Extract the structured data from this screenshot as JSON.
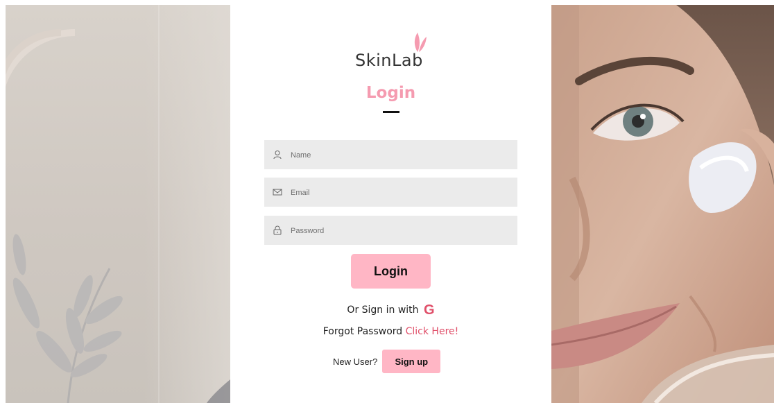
{
  "brand": {
    "name_part1": "SkinL",
    "name_part2": "ab",
    "accent": "#f59bb0",
    "link_color": "#e0506a"
  },
  "form": {
    "title": "Login",
    "fields": {
      "name_placeholder": "Name",
      "email_placeholder": "Email",
      "password_placeholder": "Password"
    },
    "login_button": "Login",
    "or_sign_in_text": "Or Sign in with",
    "google_icon_glyph": "G",
    "forgot_text": "Forgot Password",
    "forgot_link": "Click Here!",
    "new_user_text": "New User?",
    "signup_button": "Sign up"
  },
  "icons": {
    "name": "user-icon",
    "email": "mail-icon",
    "password": "lock-icon",
    "google": "google-icon",
    "logo_leaf": "leaf-icon"
  }
}
